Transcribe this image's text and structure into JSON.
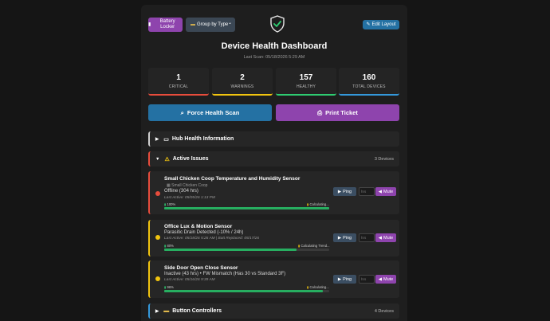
{
  "header": {
    "battery_label": "Battery Locker",
    "group_label": "Group by Type",
    "edit_label": "Edit Layout",
    "title": "Device Health Dashboard",
    "last_scan": "Last Scan: 05/18/2026 5:29 AM"
  },
  "stats": [
    {
      "value": "1",
      "label": "CRITICAL",
      "color": "#e74c3c"
    },
    {
      "value": "2",
      "label": "WARNINGS",
      "color": "#f1c40f"
    },
    {
      "value": "157",
      "label": "HEALTHY",
      "color": "#2ecc71"
    },
    {
      "value": "160",
      "label": "TOTAL DEVICES",
      "color": "#3498db"
    }
  ],
  "actions": {
    "scan_label": "Force Health Scan",
    "print_label": "Print Ticket"
  },
  "sections": {
    "hub": {
      "label": "Hub Health Information"
    },
    "issues": {
      "label": "Active Issues",
      "count": "3 Devices"
    },
    "buttons": {
      "label": "Button Controllers",
      "count": "4 Devices"
    }
  },
  "devices": [
    {
      "name": "Small Chicken Coop Temperature and Humidity Sensor",
      "room": "Small Chicken Coop",
      "status": "Offline (304 hrs)",
      "last_active": "Last Active: 05/05/26 1:13 PM",
      "battery": "100%",
      "battery_level": 1.0,
      "trend": "Calculating...",
      "severity": "critical"
    },
    {
      "name": "Office Lux & Motion Sensor",
      "status": "Parasitic Drain Detected (-10% / 24h)",
      "last_active": "Last Active: 05/18/26 5:26 AM | Batt Replaced: 05/17/26",
      "battery": "80%",
      "battery_level": 0.8,
      "trend": "Calculating Trend...",
      "severity": "warning"
    },
    {
      "name": "Side Door Open Close Sensor",
      "status": "Inactive (43 hrs) • FW Mismatch (Has 30 vs Standard 3F)",
      "last_active": "Last Active: 05/16/26 9:39 AM",
      "battery": "96%",
      "battery_level": 0.96,
      "trend": "Calculating...",
      "severity": "warning"
    }
  ],
  "controls": {
    "ping_label": "Ping",
    "mute_label": "Mute",
    "hrs_placeholder": "hrs"
  },
  "colors": {
    "critical": "#e74c3c",
    "warning": "#f1c40f",
    "info": "#3498db",
    "neutral": "#cfcfcf",
    "accent_purple": "#8e44ad",
    "accent_blue": "#2471a3"
  },
  "icons": {
    "battery": "battery-icon",
    "folder": "folder-icon",
    "edit": "pencil-icon",
    "shield": "shield-check-icon",
    "scan": "scan-icon",
    "print": "printer-icon",
    "monitor": "monitor-icon",
    "warning": "warning-icon",
    "ping": "ping-icon",
    "mute": "mute-icon"
  }
}
